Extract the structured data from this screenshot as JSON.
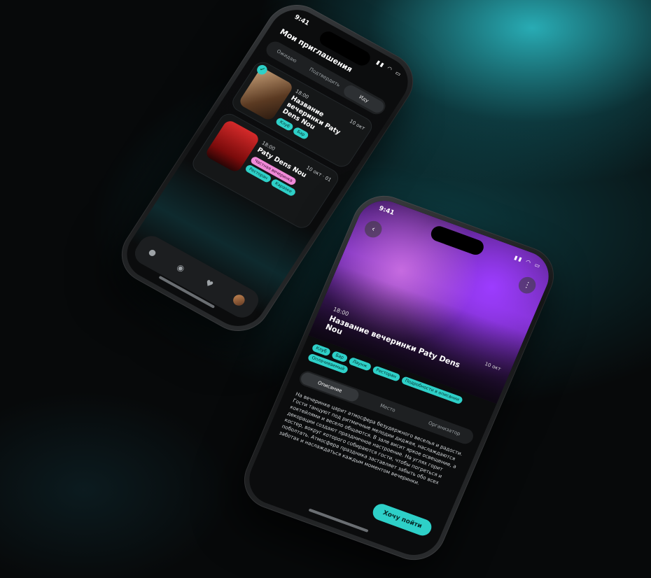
{
  "phone1": {
    "status_time": "9:41",
    "status_icons": "▮▮ ◠ ▭",
    "title": "Мои приглашения",
    "segments": [
      "Ожидаю",
      "Подтвердить",
      "Иду"
    ],
    "cards": [
      {
        "time": "18:00",
        "date": "10 окт",
        "name": "Название вечеринки Paty Dens Nou",
        "chips": [
          "Клуб",
          "Бар"
        ]
      },
      {
        "time": "18:00",
        "date": "10 окт · 01",
        "name": "Paty Dens Nou",
        "chips": [
          "Частная вечеринка",
          "Ресторан",
          "Караоке"
        ]
      }
    ],
    "tabbar": [
      "chat-icon",
      "location-icon",
      "heart-icon",
      "avatar"
    ]
  },
  "phone2": {
    "status_time": "9:41",
    "status_icons": "▮▮ ◠ ▭",
    "hero_time": "18:00",
    "hero_date": "10 окт",
    "hero_title": "Название вечеринки Paty Dens Nou",
    "chips": [
      "Клуб",
      "Бар",
      "Лаунж",
      "Ресторан",
      "Подробности в описании",
      "Оплачиваемый"
    ],
    "tabs": [
      "Описание",
      "Место",
      "Организатор"
    ],
    "description": "На вечеринке царит атмосфера безудержного веселья и радости. Гости танцуют под ритмичные мелодии диджея, наслаждаются коктейлями и весело общаются. В зале висит яркое освещение, а декорации создают праздничное настроение. На углях горит костер, вокруг которого собираются гости, чтобы погреться и поболтать. Атмосфера праздника заставляет забыть обо всех заботах и наслаждаться каждым моментом вечеринки.",
    "cta": "Хочу пойти"
  },
  "colors": {
    "accent": "#2ed0c8",
    "pink": "#f08ad8",
    "background": "#07090a"
  }
}
